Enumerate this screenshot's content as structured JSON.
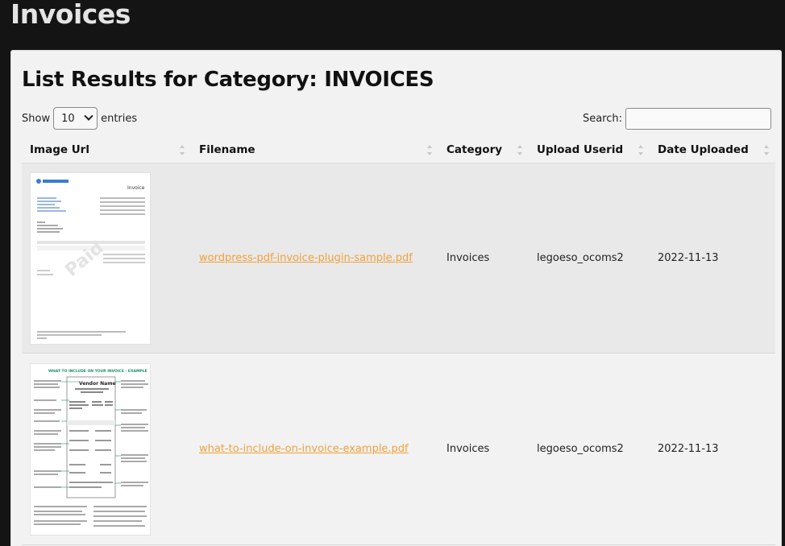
{
  "page": {
    "title": "Invoices"
  },
  "panel": {
    "heading": "List Results for Category: INVOICES"
  },
  "length": {
    "show_label": "Show",
    "value": "10",
    "entries_label": "entries"
  },
  "search": {
    "label": "Search:",
    "value": "",
    "placeholder": ""
  },
  "table": {
    "columns": [
      "Image Url",
      "Filename",
      "Category",
      "Upload Userid",
      "Date Uploaded"
    ],
    "rows": [
      {
        "thumbnail": "invoice-document-thumbnail",
        "filename": "wordpress-pdf-invoice-plugin-sample.pdf",
        "category": "Invoices",
        "userid": "legoeso_ocoms2",
        "date": "2022-11-13"
      },
      {
        "thumbnail": "invoice-example-thumbnail",
        "filename": "what-to-include-on-invoice-example.pdf",
        "category": "Invoices",
        "userid": "legoeso_ocoms2",
        "date": "2022-11-13"
      }
    ]
  },
  "thumb1": {
    "title": "Invoice",
    "stamp": "Paid"
  },
  "thumb2": {
    "title": "WHAT TO INCLUDE ON YOUR INVOICE - EXAMPLE",
    "vendor": "Vendor Name"
  },
  "colors": {
    "background": "#141414",
    "panel": "#f2f2f2",
    "link": "#f0a13a",
    "row_stripe": "#e9e9e9"
  }
}
